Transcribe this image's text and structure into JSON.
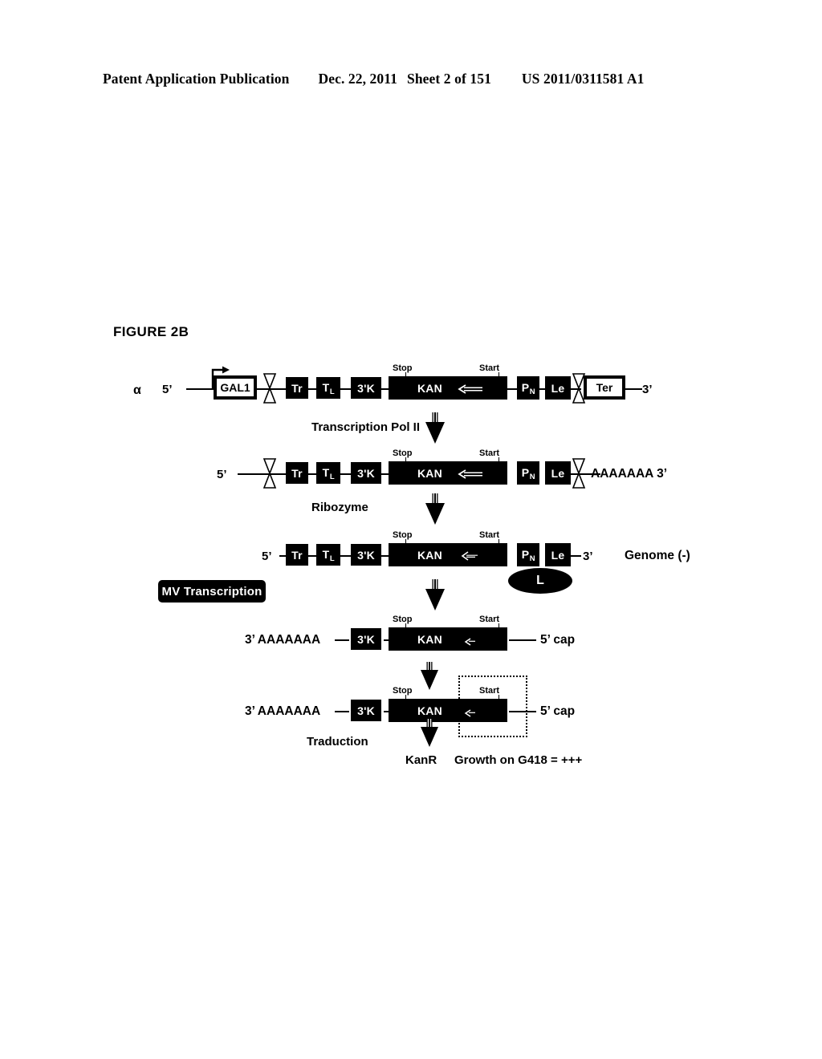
{
  "header": {
    "publication": "Patent Application Publication",
    "date": "Dec. 22, 2011",
    "sheet": "Sheet 2 of 151",
    "number": "US 2011/0311581 A1"
  },
  "figure": {
    "title": "FIGURE 2B"
  },
  "labels": {
    "alpha": "α",
    "five_prime": "5’",
    "three_prime": "3’",
    "polyA_three": "AAAAAAA 3’",
    "three_polyA": "3’ AAAAAAA",
    "five_cap": "5’ cap",
    "genome_minus": "Genome (-)",
    "stop": "Stop",
    "start": "Start",
    "kanr": "KanR",
    "growth": "Growth on G418 = +++"
  },
  "elements": {
    "gal1": "GAL1",
    "ter": "Ter",
    "tr": "Tr",
    "tl": "T",
    "tl_sub": "L",
    "three_k": "3'K",
    "kan": "KAN",
    "pn": "P",
    "pn_sub": "N",
    "le": "Le",
    "l_polymerase": "L"
  },
  "steps": [
    {
      "label": "Transcription Pol II"
    },
    {
      "label": "Ribozyme"
    },
    {
      "label": "MV Transcription"
    },
    {
      "label": "Traduction"
    }
  ],
  "rows": [
    {
      "name": "dna-construct",
      "left_label": "5’",
      "right_label": "3’",
      "parts": [
        "GAL1",
        "ribozyme",
        "Tr",
        "TL",
        "3'K",
        "KAN",
        "PN",
        "Le",
        "ribozyme",
        "Ter"
      ]
    },
    {
      "name": "pol2-transcript",
      "left_label": "5’",
      "right_label": "AAAAAAA 3’",
      "parts": [
        "ribozyme",
        "Tr",
        "TL",
        "3'K",
        "KAN",
        "PN",
        "Le",
        "ribozyme"
      ]
    },
    {
      "name": "negative-genome",
      "left_label": "5’",
      "right_label": "3’",
      "annotation": "Genome (-)",
      "parts": [
        "Tr",
        "TL",
        "3'K",
        "KAN",
        "PN",
        "Le"
      ]
    },
    {
      "name": "mrna-transcript",
      "left_label": "3’ AAAAAAA",
      "right_label": "5’ cap",
      "parts": [
        "3'K",
        "KAN"
      ]
    },
    {
      "name": "mrna-transcript-translated",
      "left_label": "3’ AAAAAAA",
      "right_label": "5’ cap",
      "parts": [
        "3'K",
        "KAN"
      ]
    }
  ],
  "colors": {
    "ink": "#000000",
    "paper": "#ffffff"
  }
}
